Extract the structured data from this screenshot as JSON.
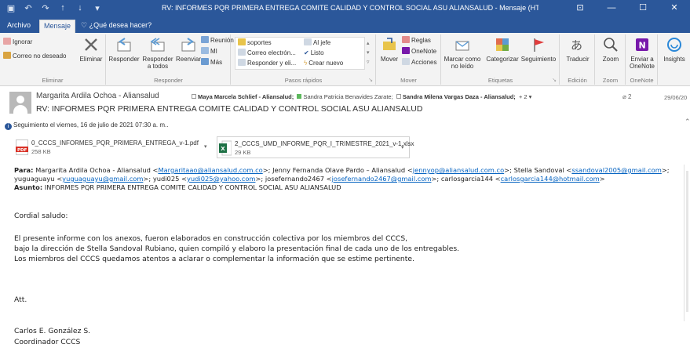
{
  "window": {
    "title": "RV: INFORMES PQR PRIMERA ENTREGA COMITE CALIDAD Y CONTROL SOCIAL ASU ALIANSALUD - Mensaje (HTML)",
    "controls": [
      "⊡",
      "—",
      "☐",
      "✕"
    ]
  },
  "quick_access": [
    "save-icon",
    "undo-icon",
    "redo-icon",
    "up-icon",
    "down-icon",
    "customize-icon"
  ],
  "tabs": {
    "file": "Archivo",
    "message": "Mensaje",
    "tell_me": "¿Qué desea hacer?"
  },
  "ribbon": {
    "eliminar": {
      "ignore": "Ignorar",
      "junk": "Correo no deseado",
      "delete": "Eliminar",
      "label": "Eliminar"
    },
    "responder": {
      "reply": "Responder",
      "reply_all_l1": "Responder",
      "reply_all_l2": "a todos",
      "forward": "Reenviar",
      "meeting": "Reunión",
      "im": "MI",
      "more": "Más",
      "label": "Responder"
    },
    "pasos": {
      "items": [
        "soportes",
        "Correo electrón...",
        "Responder y eli...",
        "Al jefe",
        "Listo",
        "Crear nuevo"
      ],
      "label": "Pasos rápidos"
    },
    "mover": {
      "move": "Mover",
      "rules": "Reglas",
      "onenote": "OneNote",
      "actions": "Acciones",
      "label": "Mover"
    },
    "etiquetas": {
      "unread_l1": "Marcar como",
      "unread_l2": "no leído",
      "categorize": "Categorizar",
      "followup": "Seguimiento",
      "label": "Etiquetas"
    },
    "edicion": {
      "translate": "Traducir",
      "label": "Edición"
    },
    "zoom": {
      "zoom": "Zoom",
      "label": "Zoom"
    },
    "onenote": {
      "send_l1": "Enviar a",
      "send_l2": "OneNote",
      "label": "OneNote"
    },
    "insights": {
      "label": "Insights"
    }
  },
  "header": {
    "from": "Margarita Ardila Ochoa - Aliansalud",
    "recipients": [
      {
        "name": "Maya Marcela Schlief - Aliansalud;",
        "bold": true,
        "presence": "none"
      },
      {
        "name": "Sandra Patricia Benavides Zarate;",
        "bold": false,
        "presence": "green"
      },
      {
        "name": "Sandra Milena Vargas Daza - Aliansalud;",
        "bold": true,
        "presence": "none"
      }
    ],
    "more_recipients": "+ 2",
    "attachment_count": "2",
    "date": "29/06/20",
    "subject": "RV: INFORMES PQR PRIMERA ENTREGA COMITE CALIDAD Y CONTROL SOCIAL ASU ALIANSALUD",
    "followup": "Seguimiento el viernes, 16 de julio de 2021 07:30 a. m.."
  },
  "attachments": [
    {
      "name": "0_CCCS_INFORMES_PQR_PRIMERA_ENTREGA_v-1.pdf",
      "size": "258 KB",
      "type": "PDF"
    },
    {
      "name": "2_CCCS_UMD_INFORME_PQR_I_TRIMESTRE_2021_v-1.xlsx",
      "size": "29 KB",
      "type": "X"
    }
  ],
  "body": {
    "para_label": "Para:",
    "to": [
      {
        "name": "Margarita Ardila Ochoa - Aliansalud <",
        "email": "Margaritaao@aliansalud.com.co",
        "sep": ">; "
      },
      {
        "name": "Jenny Fernanda Olave Pardo – Aliansalud <",
        "email": "jennyop@aliansalud.com.co",
        "sep": ">; "
      },
      {
        "name": "Stella Sandoval <",
        "email": "ssandoval2005@gmail.com",
        "sep": ">;"
      }
    ],
    "to2": [
      {
        "name": "yuguaguayu <",
        "email": "yuguaguayu@gmail.com",
        "sep": ">; "
      },
      {
        "name": "yudi025 <",
        "email": "yudi025@yahoo.com",
        "sep": ">; "
      },
      {
        "name": "josefernando2467 <",
        "email": "josefernando2467@gmail.com",
        "sep": ">; "
      },
      {
        "name": "carlosgarcia144 <",
        "email": "carlosgarcia144@hotmail.com",
        "sep": ">"
      }
    ],
    "asunto_label": "Asunto:",
    "asunto": "INFORMES PQR PRIMERA ENTREGA COMITE CALIDAD Y CONTROL SOCIAL ASU ALIANSALUD",
    "greeting": "Cordial saludo:",
    "p1": "El presente informe con los anexos, fueron elaborados en construcción colectiva por los miembros del CCCS,",
    "p2": "bajo la dirección de Stella Sandoval Rubiano, quien compiló y elaboro la presentación final de cada uno de los entregables.",
    "p3": "Los miembros del CCCS quedamos atentos a aclarar o complementar la información que se estime pertinente.",
    "att": "Att.",
    "sig1": "Carlos E. González S.",
    "sig2": "Coordinador CCCS"
  },
  "colors": {
    "accent": "#2b579a",
    "link": "#0563c1",
    "ribbon_bg": "#f3f3f3"
  }
}
